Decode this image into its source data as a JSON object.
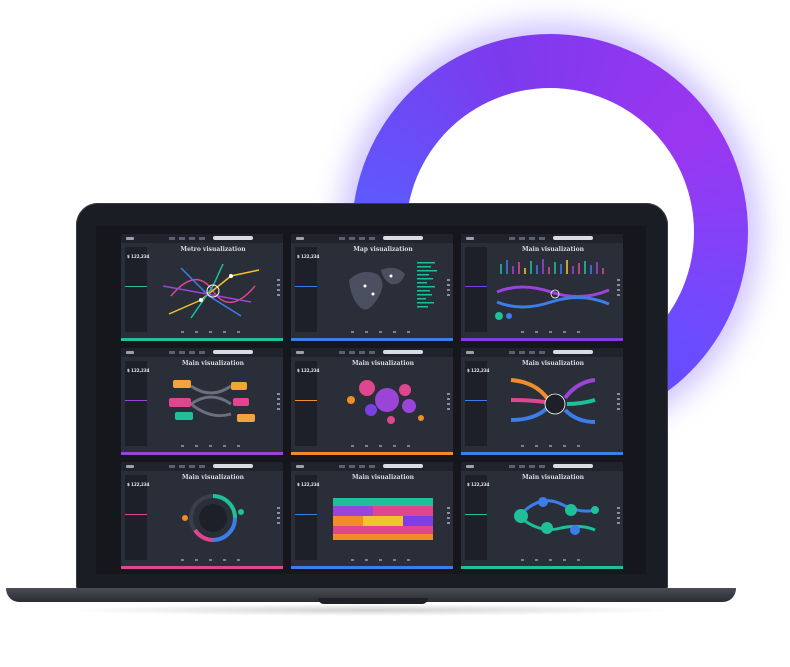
{
  "colors": {
    "ring_start": "#4f46f5",
    "ring_end": "#9b36f0",
    "bezel": "#1b1d24",
    "tile_background": "#2a2e38"
  },
  "tiles": [
    {
      "title": "Metro visualization",
      "value": "$ 122,234",
      "accent": "#1fbf9a",
      "viz": "metro-map"
    },
    {
      "title": "Map visualization",
      "value": "$ 122,234",
      "accent": "#3b7de9",
      "viz": "world-map"
    },
    {
      "title": "Main visualization",
      "value": "",
      "accent": "#7b3fe4",
      "viz": "wave-bars"
    },
    {
      "title": "Main visualization",
      "value": "$ 122,234",
      "accent": "#9b44d8",
      "viz": "flow-boxes"
    },
    {
      "title": "Main visualization",
      "value": "$ 122,234",
      "accent": "#f28c28",
      "viz": "bubble-cluster"
    },
    {
      "title": "Main visualization",
      "value": "$ 122,234",
      "accent": "#3b7de9",
      "viz": "sankey-radial"
    },
    {
      "title": "Main visualization",
      "value": "$ 122,234",
      "accent": "#e0468f",
      "viz": "ring-donut"
    },
    {
      "title": "Main visualization",
      "value": "$ 122,234",
      "accent": "#3b7de9",
      "viz": "hex-heatmap"
    },
    {
      "title": "Main visualization",
      "value": "$ 122,234",
      "accent": "#1fbf9a",
      "viz": "node-tree"
    }
  ]
}
